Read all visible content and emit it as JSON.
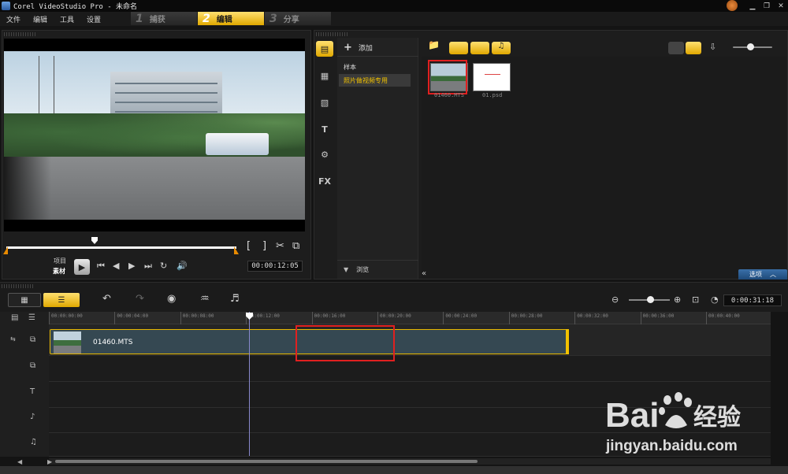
{
  "window": {
    "title": "Corel VideoStudio Pro - 未命名"
  },
  "menu": {
    "items": [
      "文件",
      "编辑",
      "工具",
      "设置"
    ]
  },
  "steps": [
    {
      "num": "1",
      "label": "捕获",
      "active": false
    },
    {
      "num": "2",
      "label": "编辑",
      "active": true
    },
    {
      "num": "3",
      "label": "分享",
      "active": false
    }
  ],
  "preview": {
    "project_label": "项目",
    "clip_label": "素材",
    "timecode": "00:00:12:05",
    "scrub_position": 0.39
  },
  "library": {
    "add_label": "添加",
    "tree": [
      "样本",
      "照片做视频专用"
    ],
    "browse_label": "浏览",
    "options_label": "选项",
    "thumbnails": [
      {
        "caption": "01460.MTS",
        "selected": true
      },
      {
        "caption": "01.psd",
        "selected": false
      }
    ]
  },
  "timeline": {
    "timecode": "0:00:31:18",
    "ruler": [
      "00:00:00:00",
      "00:00:04:00",
      "00:00:08:00",
      "00:00:12:00",
      "00:00:16:00",
      "00:00:20:00",
      "00:00:24:00",
      "00:00:28:00",
      "00:00:32:00",
      "00:00:36:00",
      "00:00:40:00"
    ],
    "clip_name": "01460.MTS",
    "zoom_level": 0.5
  },
  "watermark": {
    "text": "Bai经验",
    "url": "jingyan.baidu.com"
  },
  "colors": {
    "accent": "#e0a800",
    "highlight": "#e02020",
    "clip": "#354852"
  }
}
